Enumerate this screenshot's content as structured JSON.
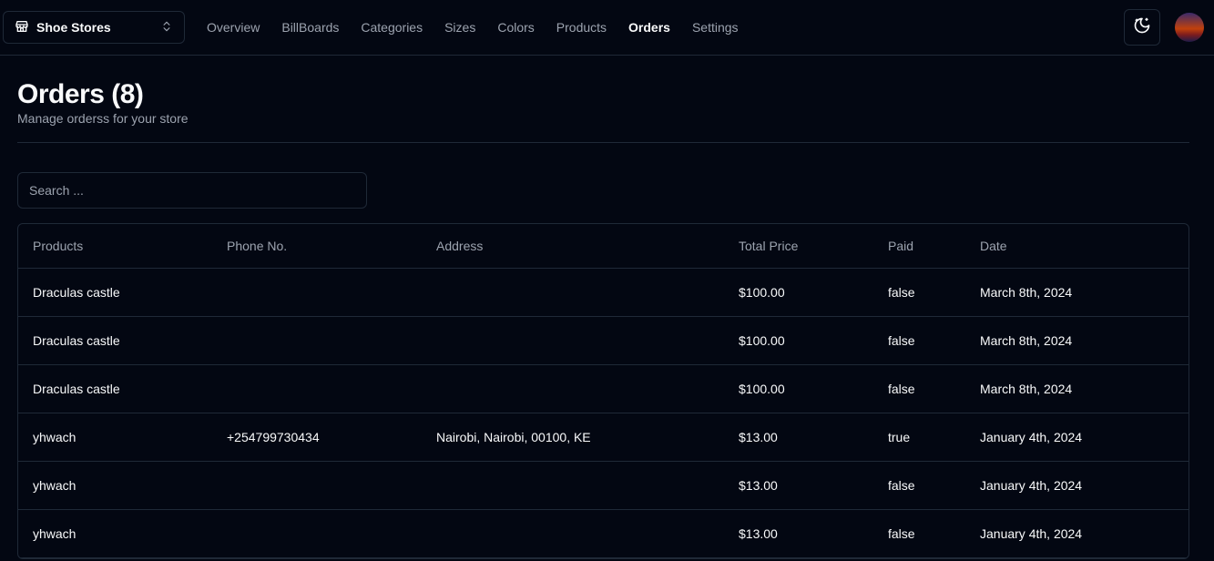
{
  "navbar": {
    "store_name": "Shoe Stores",
    "links": [
      {
        "label": "Overview"
      },
      {
        "label": "BillBoards"
      },
      {
        "label": "Categories"
      },
      {
        "label": "Sizes"
      },
      {
        "label": "Colors"
      },
      {
        "label": "Products"
      },
      {
        "label": "Orders",
        "active": true
      },
      {
        "label": "Settings"
      }
    ]
  },
  "header": {
    "title": "Orders (8)",
    "description": "Manage orderss for your store"
  },
  "search": {
    "placeholder": "Search ..."
  },
  "table": {
    "columns": [
      "Products",
      "Phone No.",
      "Address",
      "Total Price",
      "Paid",
      "Date"
    ],
    "rows": [
      [
        "Draculas castle",
        "",
        "",
        "$100.00",
        "false",
        "March 8th, 2024"
      ],
      [
        "Draculas castle",
        "",
        "",
        "$100.00",
        "false",
        "March 8th, 2024"
      ],
      [
        "Draculas castle",
        "",
        "",
        "$100.00",
        "false",
        "March 8th, 2024"
      ],
      [
        "yhwach",
        "+254799730434",
        "Nairobi, Nairobi, 00100, KE",
        "$13.00",
        "true",
        "January 4th, 2024"
      ],
      [
        "yhwach",
        "",
        "",
        "$13.00",
        "false",
        "January 4th, 2024"
      ],
      [
        "yhwach",
        "",
        "",
        "$13.00",
        "false",
        "January 4th, 2024"
      ]
    ]
  }
}
